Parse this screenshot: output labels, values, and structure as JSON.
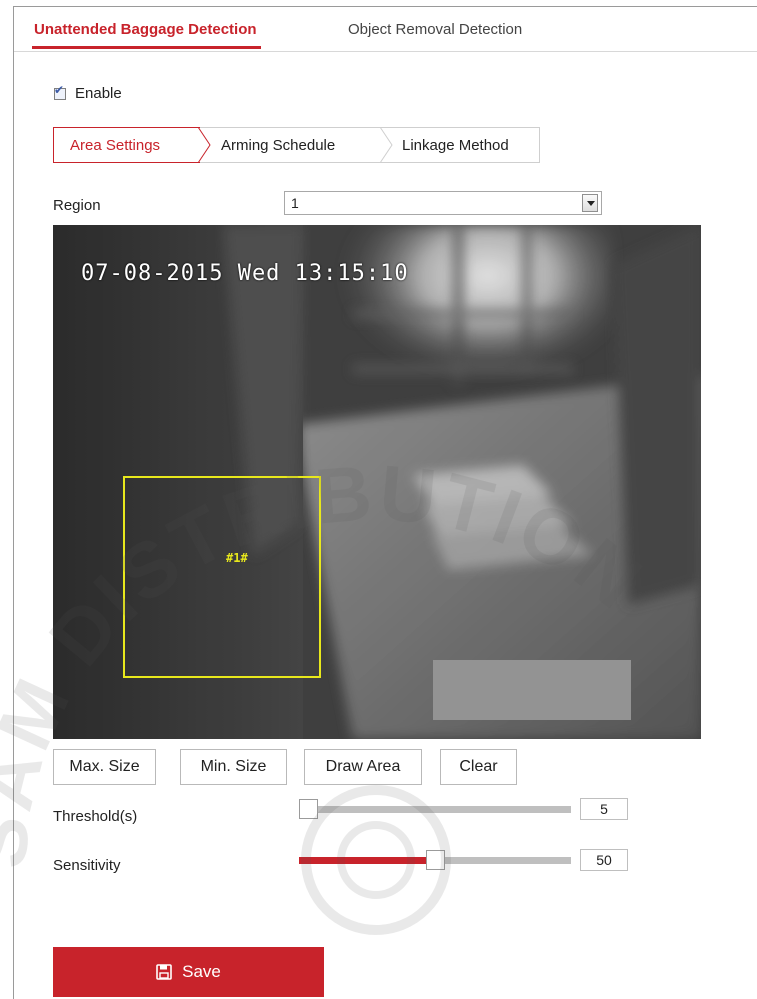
{
  "tabs": [
    {
      "label": "Unattended Baggage Detection",
      "active": true
    },
    {
      "label": "Object Removal Detection",
      "active": false
    }
  ],
  "enable": {
    "label": "Enable",
    "checked": true
  },
  "subtabs": [
    {
      "label": "Area Settings",
      "active": true
    },
    {
      "label": "Arming Schedule",
      "active": false
    },
    {
      "label": "Linkage Method",
      "active": false
    }
  ],
  "region": {
    "label": "Region",
    "value": "1"
  },
  "video": {
    "osd_timestamp": "07-08-2015 Wed 13:15:10",
    "area_label": "#1#"
  },
  "buttons": {
    "max_size": "Max. Size",
    "min_size": "Min. Size",
    "draw_area": "Draw Area",
    "clear": "Clear"
  },
  "threshold": {
    "label": "Threshold(s)",
    "value": "5",
    "fraction": 0.0
  },
  "sensitivity": {
    "label": "Sensitivity",
    "value": "50",
    "fraction": 0.5
  },
  "save": {
    "label": "Save",
    "icon": "floppy-disk-icon"
  },
  "watermark": "SAM DISTRIBUTION",
  "colors": {
    "accent": "#c8232b",
    "area_outline": "#e8e81c"
  }
}
